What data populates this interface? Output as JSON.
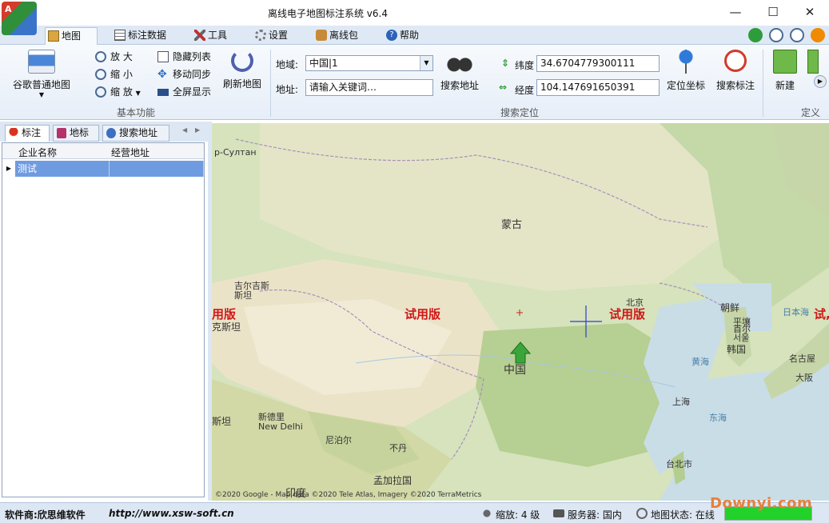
{
  "window": {
    "title": "离线电子地图标注系统 v6.4"
  },
  "tabs": [
    {
      "label": "地图"
    },
    {
      "label": "标注数据"
    },
    {
      "label": "工具"
    },
    {
      "label": "设置"
    },
    {
      "label": "离线包"
    },
    {
      "label": "帮助"
    }
  ],
  "ribbon": {
    "map_type": "谷歌普通地图",
    "zoom_in": "放  大",
    "zoom_out": "缩  小",
    "zoom": "缩  放",
    "hide_list": "隐藏列表",
    "move_sync": "移动同步",
    "fullscreen": "全屏显示",
    "refresh": "刷新地图",
    "group_basic": "基本功能",
    "region_label": "地域:",
    "region_value": "中国|1",
    "address_label": "地址:",
    "address_placeholder": "请输入关键词…",
    "search_address": "搜索地址",
    "lat_label": "纬度",
    "lat_value": "34.6704779300111",
    "lng_label": "经度",
    "lng_value": "104.147691650391",
    "locate": "定位坐标",
    "search_mark": "搜索标注",
    "group_search": "搜索定位",
    "new": "新建",
    "group_def": "定义"
  },
  "panel": {
    "tabs": [
      "标注",
      "地标",
      "搜索地址"
    ],
    "columns": [
      "企业名称",
      "经营地址"
    ],
    "rows": [
      {
        "name": "测试",
        "address": ""
      }
    ]
  },
  "map": {
    "labels": {
      "mongolia": "蒙古",
      "china": "中国",
      "north_korea": "朝鲜",
      "korea": "韩国",
      "pyongyang": "平壤",
      "seoul": "首尔\n서울",
      "beijing": "北京",
      "shanghai": "上海",
      "taipei": "台北市",
      "new_delhi": "新德里\nNew Delhi",
      "nepal": "尼泊尔",
      "bhutan": "不丹",
      "bangladesh": "孟加拉国",
      "india": "印度",
      "yellow_sea": "黄海",
      "east_sea": "东海",
      "japan_sea": "日本海",
      "nagoya": "名古屋",
      "osaka": "大阪",
      "kyrgyz": "吉尔吉斯\n斯坦",
      "kazakh": "克斯坦",
      "nur_sultan": "р-Султан",
      "stan": "斯坦"
    },
    "trial": [
      "用版",
      "试用版",
      "试用版",
      "试,"
    ],
    "credit": "©2020 Google - Map data ©2020 Tele Atlas, Imagery ©2020 TerraMetrics"
  },
  "status": {
    "vendor": "软件商:欣思维软件",
    "url": "http://www.xsw-soft.cn",
    "zoom": "缩放: 4 级",
    "server": "服务器: 国内",
    "map_state": "地图状态: 在线",
    "progress": 1.0
  },
  "watermark": "Downyi.com"
}
